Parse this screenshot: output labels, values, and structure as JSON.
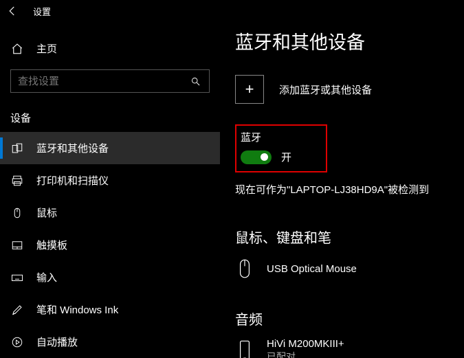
{
  "titlebar": {
    "title": "设置"
  },
  "home": {
    "label": "主页"
  },
  "search": {
    "placeholder": "查找设置"
  },
  "section": "设备",
  "nav": {
    "bluetooth": "蓝牙和其他设备",
    "printers": "打印机和扫描仪",
    "mouse": "鼠标",
    "touchpad": "触摸板",
    "typing": "输入",
    "pen": "笔和 Windows Ink",
    "autoplay": "自动播放"
  },
  "main": {
    "title": "蓝牙和其他设备",
    "add_device": "添加蓝牙或其他设备",
    "bt_label": "蓝牙",
    "bt_state": "开",
    "status": "现在可作为\"LAPTOP-LJ38HD9A\"被检测到",
    "section_mouse": "鼠标、键盘和笔",
    "device_mouse": "USB Optical Mouse",
    "section_audio": "音频",
    "device_audio": "HiVi M200MKIII+",
    "device_audio_sub": "已配对"
  }
}
